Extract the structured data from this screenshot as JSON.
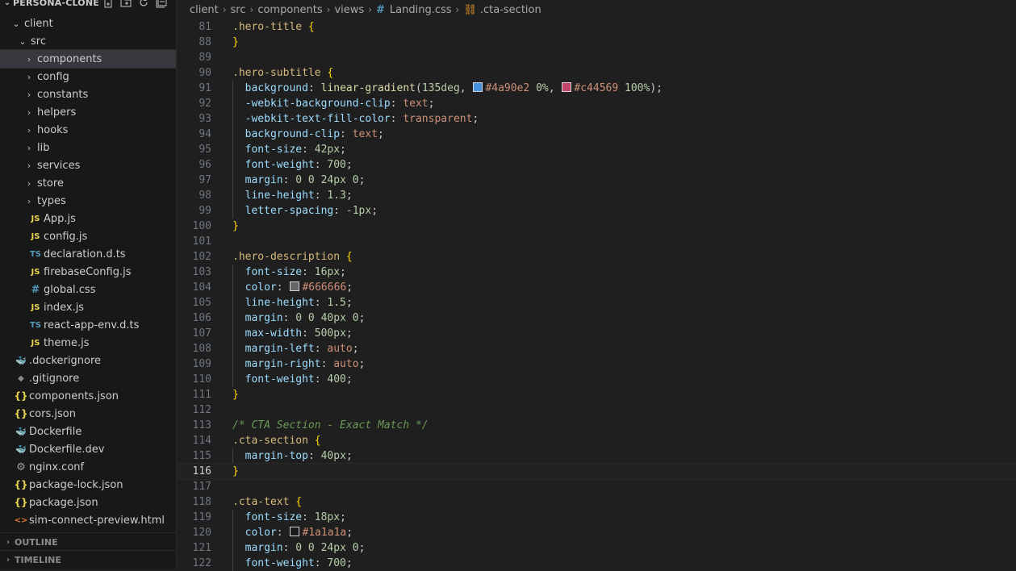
{
  "explorer": {
    "title": "PERSONA-CLONE",
    "tree": [
      {
        "label": "client",
        "type": "folder",
        "open": true,
        "depth": 0
      },
      {
        "label": "src",
        "type": "folder",
        "open": true,
        "depth": 1
      },
      {
        "label": "components",
        "type": "folder",
        "open": false,
        "depth": 2,
        "selected": true
      },
      {
        "label": "config",
        "type": "folder",
        "open": false,
        "depth": 2
      },
      {
        "label": "constants",
        "type": "folder",
        "open": false,
        "depth": 2
      },
      {
        "label": "helpers",
        "type": "folder",
        "open": false,
        "depth": 2
      },
      {
        "label": "hooks",
        "type": "folder",
        "open": false,
        "depth": 2
      },
      {
        "label": "lib",
        "type": "folder",
        "open": false,
        "depth": 2
      },
      {
        "label": "services",
        "type": "folder",
        "open": false,
        "depth": 2
      },
      {
        "label": "store",
        "type": "folder",
        "open": false,
        "depth": 2
      },
      {
        "label": "types",
        "type": "folder",
        "open": false,
        "depth": 2
      },
      {
        "label": "App.js",
        "type": "js",
        "depth": 2
      },
      {
        "label": "config.js",
        "type": "js",
        "depth": 2
      },
      {
        "label": "declaration.d.ts",
        "type": "ts",
        "depth": 2
      },
      {
        "label": "firebaseConfig.js",
        "type": "js",
        "depth": 2
      },
      {
        "label": "global.css",
        "type": "css",
        "depth": 2
      },
      {
        "label": "index.js",
        "type": "js",
        "depth": 2
      },
      {
        "label": "react-app-env.d.ts",
        "type": "ts",
        "depth": 2
      },
      {
        "label": "theme.js",
        "type": "js",
        "depth": 2
      },
      {
        "label": ".dockerignore",
        "type": "docker",
        "depth": 1
      },
      {
        "label": ".gitignore",
        "type": "git",
        "depth": 1
      },
      {
        "label": "components.json",
        "type": "json",
        "depth": 1
      },
      {
        "label": "cors.json",
        "type": "json",
        "depth": 1
      },
      {
        "label": "Dockerfile",
        "type": "docker",
        "depth": 1
      },
      {
        "label": "Dockerfile.dev",
        "type": "docker",
        "depth": 1
      },
      {
        "label": "nginx.conf",
        "type": "gear",
        "depth": 1
      },
      {
        "label": "package-lock.json",
        "type": "json",
        "depth": 1
      },
      {
        "label": "package.json",
        "type": "json",
        "depth": 1
      },
      {
        "label": "sim-connect-preview.html",
        "type": "html",
        "depth": 1
      }
    ],
    "outline_label": "OUTLINE",
    "timeline_label": "TIMELINE"
  },
  "breadcrumbs": [
    "client",
    "src",
    "components",
    "views",
    "Landing.css",
    ".cta-section"
  ],
  "editor": {
    "current_line": 116,
    "lines": [
      {
        "n": 81,
        "t": [
          [
            "sel",
            ".hero-title"
          ],
          [
            "punc",
            " "
          ],
          [
            "brace",
            "{"
          ]
        ]
      },
      {
        "n": 88,
        "t": [
          [
            "brace",
            "}"
          ]
        ]
      },
      {
        "n": 89,
        "t": []
      },
      {
        "n": 90,
        "t": [
          [
            "sel",
            ".hero-subtitle"
          ],
          [
            "punc",
            " "
          ],
          [
            "brace",
            "{"
          ]
        ]
      },
      {
        "n": 91,
        "i": 1,
        "t": [
          [
            "prop",
            "background"
          ],
          [
            "punc",
            ": "
          ],
          [
            "fn",
            "linear-gradient"
          ],
          [
            "punc",
            "("
          ],
          [
            "num",
            "135deg"
          ],
          [
            "punc",
            ", "
          ],
          [
            "sw",
            "#4a90e2"
          ],
          [
            "val",
            "#4a90e2"
          ],
          [
            "punc",
            " "
          ],
          [
            "num",
            "0%"
          ],
          [
            "punc",
            ", "
          ],
          [
            "sw",
            "#c44569"
          ],
          [
            "val",
            "#c44569"
          ],
          [
            "punc",
            " "
          ],
          [
            "num",
            "100%"
          ],
          [
            "punc",
            ");"
          ]
        ]
      },
      {
        "n": 92,
        "i": 1,
        "t": [
          [
            "prop",
            "-webkit-background-clip"
          ],
          [
            "punc",
            ": "
          ],
          [
            "kw",
            "text"
          ],
          [
            "punc",
            ";"
          ]
        ]
      },
      {
        "n": 93,
        "i": 1,
        "t": [
          [
            "prop",
            "-webkit-text-fill-color"
          ],
          [
            "punc",
            ": "
          ],
          [
            "kw",
            "transparent"
          ],
          [
            "punc",
            ";"
          ]
        ]
      },
      {
        "n": 94,
        "i": 1,
        "t": [
          [
            "prop",
            "background-clip"
          ],
          [
            "punc",
            ": "
          ],
          [
            "kw",
            "text"
          ],
          [
            "punc",
            ";"
          ]
        ]
      },
      {
        "n": 95,
        "i": 1,
        "t": [
          [
            "prop",
            "font-size"
          ],
          [
            "punc",
            ": "
          ],
          [
            "num",
            "42px"
          ],
          [
            "punc",
            ";"
          ]
        ]
      },
      {
        "n": 96,
        "i": 1,
        "t": [
          [
            "prop",
            "font-weight"
          ],
          [
            "punc",
            ": "
          ],
          [
            "num",
            "700"
          ],
          [
            "punc",
            ";"
          ]
        ]
      },
      {
        "n": 97,
        "i": 1,
        "t": [
          [
            "prop",
            "margin"
          ],
          [
            "punc",
            ": "
          ],
          [
            "num",
            "0 0 24px 0"
          ],
          [
            "punc",
            ";"
          ]
        ]
      },
      {
        "n": 98,
        "i": 1,
        "t": [
          [
            "prop",
            "line-height"
          ],
          [
            "punc",
            ": "
          ],
          [
            "num",
            "1.3"
          ],
          [
            "punc",
            ";"
          ]
        ]
      },
      {
        "n": 99,
        "i": 1,
        "t": [
          [
            "prop",
            "letter-spacing"
          ],
          [
            "punc",
            ": "
          ],
          [
            "num",
            "-1px"
          ],
          [
            "punc",
            ";"
          ]
        ]
      },
      {
        "n": 100,
        "t": [
          [
            "brace",
            "}"
          ]
        ]
      },
      {
        "n": 101,
        "t": []
      },
      {
        "n": 102,
        "t": [
          [
            "sel",
            ".hero-description"
          ],
          [
            "punc",
            " "
          ],
          [
            "brace",
            "{"
          ]
        ]
      },
      {
        "n": 103,
        "i": 1,
        "t": [
          [
            "prop",
            "font-size"
          ],
          [
            "punc",
            ": "
          ],
          [
            "num",
            "16px"
          ],
          [
            "punc",
            ";"
          ]
        ]
      },
      {
        "n": 104,
        "i": 1,
        "t": [
          [
            "prop",
            "color"
          ],
          [
            "punc",
            ": "
          ],
          [
            "sw",
            "#666666"
          ],
          [
            "val",
            "#666666"
          ],
          [
            "punc",
            ";"
          ]
        ]
      },
      {
        "n": 105,
        "i": 1,
        "t": [
          [
            "prop",
            "line-height"
          ],
          [
            "punc",
            ": "
          ],
          [
            "num",
            "1.5"
          ],
          [
            "punc",
            ";"
          ]
        ]
      },
      {
        "n": 106,
        "i": 1,
        "t": [
          [
            "prop",
            "margin"
          ],
          [
            "punc",
            ": "
          ],
          [
            "num",
            "0 0 40px 0"
          ],
          [
            "punc",
            ";"
          ]
        ]
      },
      {
        "n": 107,
        "i": 1,
        "t": [
          [
            "prop",
            "max-width"
          ],
          [
            "punc",
            ": "
          ],
          [
            "num",
            "500px"
          ],
          [
            "punc",
            ";"
          ]
        ]
      },
      {
        "n": 108,
        "i": 1,
        "t": [
          [
            "prop",
            "margin-left"
          ],
          [
            "punc",
            ": "
          ],
          [
            "kw",
            "auto"
          ],
          [
            "punc",
            ";"
          ]
        ]
      },
      {
        "n": 109,
        "i": 1,
        "t": [
          [
            "prop",
            "margin-right"
          ],
          [
            "punc",
            ": "
          ],
          [
            "kw",
            "auto"
          ],
          [
            "punc",
            ";"
          ]
        ]
      },
      {
        "n": 110,
        "i": 1,
        "t": [
          [
            "prop",
            "font-weight"
          ],
          [
            "punc",
            ": "
          ],
          [
            "num",
            "400"
          ],
          [
            "punc",
            ";"
          ]
        ]
      },
      {
        "n": 111,
        "t": [
          [
            "brace",
            "}"
          ]
        ]
      },
      {
        "n": 112,
        "t": []
      },
      {
        "n": 113,
        "t": [
          [
            "comment",
            "/* CTA Section - Exact Match */"
          ]
        ]
      },
      {
        "n": 114,
        "t": [
          [
            "sel",
            ".cta-section"
          ],
          [
            "punc",
            " "
          ],
          [
            "brace",
            "{"
          ]
        ]
      },
      {
        "n": 115,
        "i": 1,
        "t": [
          [
            "prop",
            "margin-top"
          ],
          [
            "punc",
            ": "
          ],
          [
            "num",
            "40px"
          ],
          [
            "punc",
            ";"
          ]
        ]
      },
      {
        "n": 116,
        "t": [
          [
            "brace",
            "}"
          ]
        ]
      },
      {
        "n": 117,
        "t": []
      },
      {
        "n": 118,
        "t": [
          [
            "sel",
            ".cta-text"
          ],
          [
            "punc",
            " "
          ],
          [
            "brace",
            "{"
          ]
        ]
      },
      {
        "n": 119,
        "i": 1,
        "t": [
          [
            "prop",
            "font-size"
          ],
          [
            "punc",
            ": "
          ],
          [
            "num",
            "18px"
          ],
          [
            "punc",
            ";"
          ]
        ]
      },
      {
        "n": 120,
        "i": 1,
        "t": [
          [
            "prop",
            "color"
          ],
          [
            "punc",
            ": "
          ],
          [
            "sw",
            "#1a1a1a"
          ],
          [
            "val",
            "#1a1a1a"
          ],
          [
            "punc",
            ";"
          ]
        ]
      },
      {
        "n": 121,
        "i": 1,
        "t": [
          [
            "prop",
            "margin"
          ],
          [
            "punc",
            ": "
          ],
          [
            "num",
            "0 0 24px 0"
          ],
          [
            "punc",
            ";"
          ]
        ]
      },
      {
        "n": 122,
        "i": 1,
        "t": [
          [
            "prop",
            "font-weight"
          ],
          [
            "punc",
            ": "
          ],
          [
            "num",
            "700"
          ],
          [
            "punc",
            ";"
          ]
        ]
      }
    ]
  }
}
